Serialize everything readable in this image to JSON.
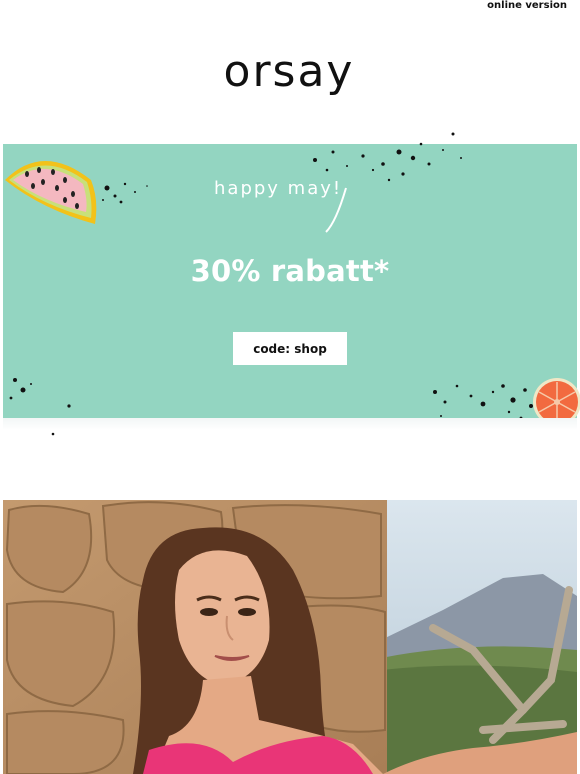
{
  "header": {
    "online_version_label": "online version",
    "brand": "orsay"
  },
  "banner": {
    "greeting": "happy may!",
    "headline": "30% rabatt*",
    "code_label": "code: shop",
    "background_color": "#93d5c1",
    "decorations": [
      "watermelon-slice-icon",
      "grapefruit-slice-icon",
      "ink-splatter"
    ]
  },
  "hero": {
    "image": "woman-leaning-on-stone-wall-photo"
  }
}
